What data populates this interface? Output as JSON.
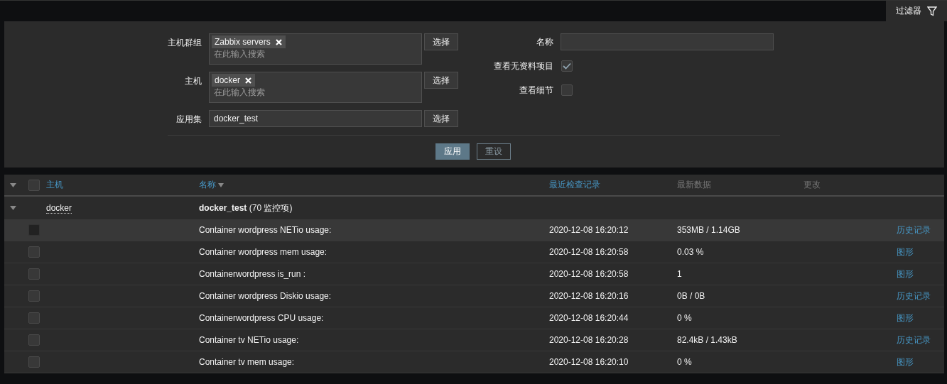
{
  "filter_tab": {
    "label": "过滤器"
  },
  "filter": {
    "left_fields": [
      {
        "kind": "multiselect",
        "label": "主机群组",
        "tags": [
          "Zabbix servers"
        ],
        "placeholder": "在此输入搜索",
        "button": "选择"
      },
      {
        "kind": "multiselect",
        "label": "主机",
        "tags": [
          "docker"
        ],
        "placeholder": "在此输入搜索",
        "button": "选择"
      },
      {
        "kind": "text",
        "label": "应用集",
        "value": "docker_test",
        "button": "选择"
      }
    ],
    "right_fields": [
      {
        "kind": "text",
        "label": "名称"
      },
      {
        "kind": "checkbox",
        "label": "查看无资料项目",
        "checked": true
      },
      {
        "kind": "checkbox",
        "label": "查看细节",
        "checked": false
      }
    ],
    "apply_button": "应用",
    "reset_button": "重设"
  },
  "table": {
    "columns": [
      {
        "label": "主机",
        "sortable": true
      },
      {
        "label": "名称",
        "sortable": true,
        "sorted": true
      },
      {
        "label": "最近检查记录",
        "sortable": true
      },
      {
        "label": "最新数据",
        "sortable": false
      },
      {
        "label": "更改",
        "sortable": false
      }
    ],
    "select_all_checked": false,
    "group": {
      "host": "docker",
      "title": "**docker_test** (70 监控项)",
      "expanded": true
    },
    "rows": [
      {
        "name": "Container wordpress NETio usage:",
        "last_check": "2020-12-08 16:20:12",
        "last_value": "353MB / 1.14GB",
        "link": "历史记录",
        "highlighted": true
      },
      {
        "name": "Container wordpress mem usage:",
        "last_check": "2020-12-08 16:20:58",
        "last_value": "0.03 %",
        "link": "图形",
        "highlighted": false
      },
      {
        "name": "Containerwordpress is_run :",
        "last_check": "2020-12-08 16:20:58",
        "last_value": "1",
        "link": "图形",
        "highlighted": false
      },
      {
        "name": "Container wordpress Diskio usage:",
        "last_check": "2020-12-08 16:20:16",
        "last_value": "0B / 0B",
        "link": "历史记录",
        "highlighted": false
      },
      {
        "name": "Containerwordpress CPU usage:",
        "last_check": "2020-12-08 16:20:44",
        "last_value": "0 %",
        "link": "图形",
        "highlighted": false
      },
      {
        "name": "Container tv NETio usage:",
        "last_check": "2020-12-08 16:20:28",
        "last_value": "82.4kB / 1.43kB",
        "link": "历史记录",
        "highlighted": false
      },
      {
        "name": "Container tv mem usage:",
        "last_check": "2020-12-08 16:20:10",
        "last_value": "0 %",
        "link": "图形",
        "highlighted": false
      }
    ]
  }
}
